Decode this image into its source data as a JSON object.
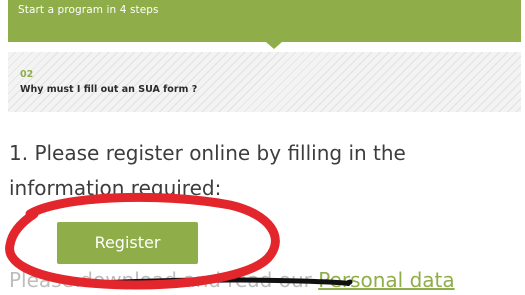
{
  "step_header": {
    "title": "Start a program in 4 steps"
  },
  "step_card": {
    "number": "02",
    "question": "Why must I fill out an SUA form ?"
  },
  "instruction": {
    "prefix": "1. Please ",
    "emphasis": "register online",
    "suffix": " by filling in the information required:"
  },
  "register_button": {
    "label": "Register"
  },
  "download_line": {
    "text": "Please download and read our ",
    "link": "Personal data"
  },
  "colors": {
    "accent": "#8fad49",
    "annotation_red": "#e3262b",
    "scribble_black": "#111111"
  }
}
